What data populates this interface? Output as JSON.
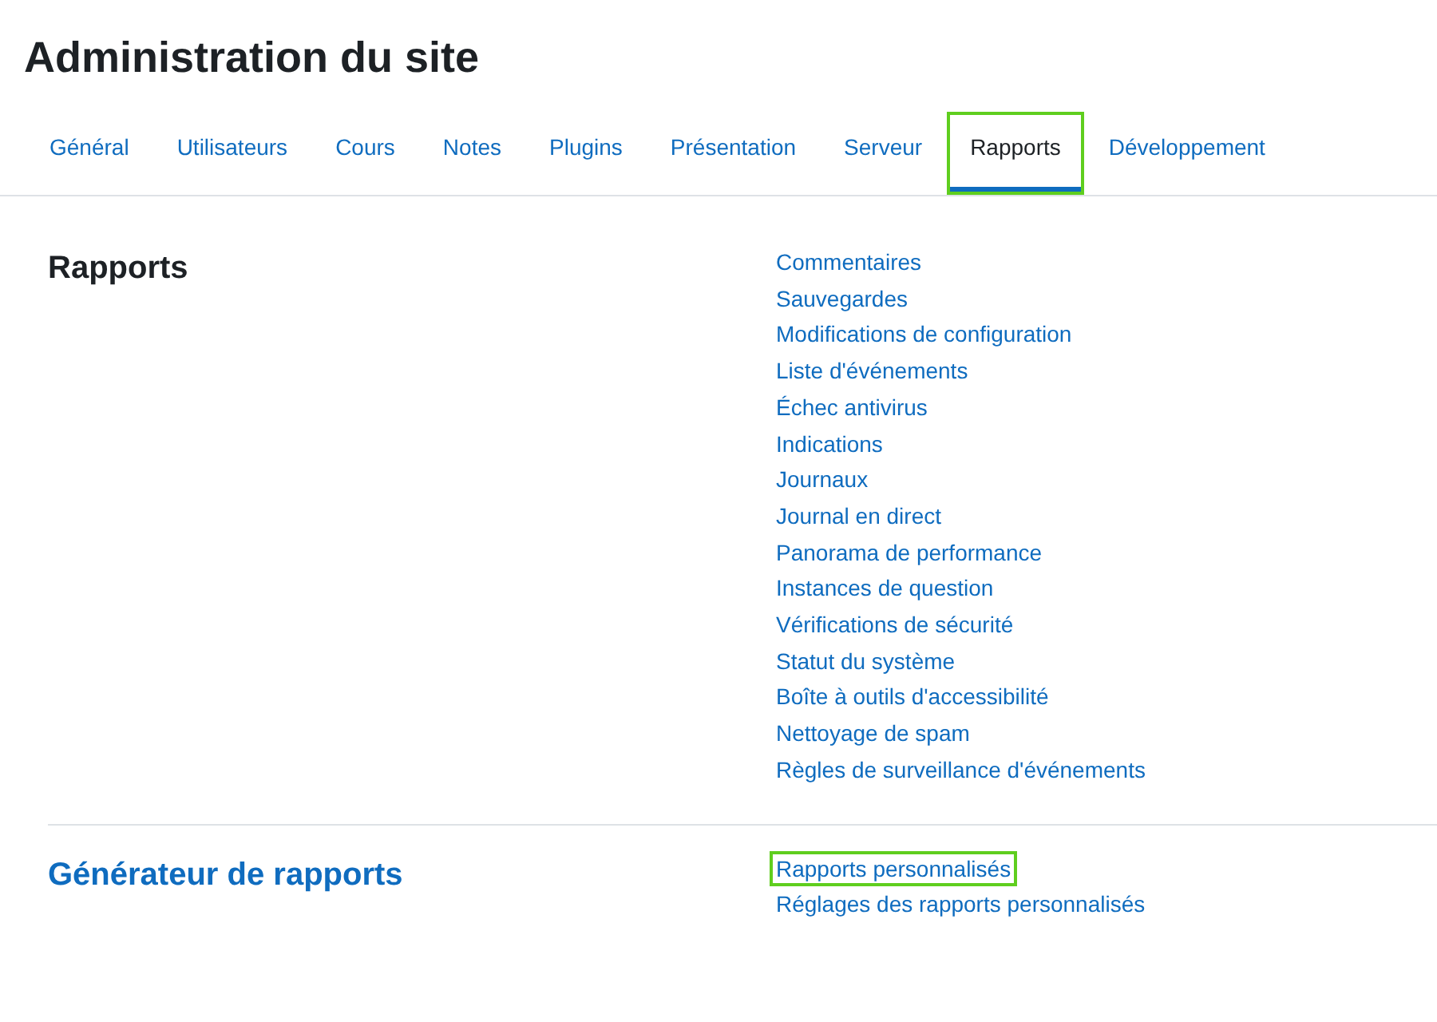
{
  "page_title": "Administration du site",
  "tabs": [
    {
      "label": "Général",
      "selected": false,
      "highlighted": false
    },
    {
      "label": "Utilisateurs",
      "selected": false,
      "highlighted": false
    },
    {
      "label": "Cours",
      "selected": false,
      "highlighted": false
    },
    {
      "label": "Notes",
      "selected": false,
      "highlighted": false
    },
    {
      "label": "Plugins",
      "selected": false,
      "highlighted": false
    },
    {
      "label": "Présentation",
      "selected": false,
      "highlighted": false
    },
    {
      "label": "Serveur",
      "selected": false,
      "highlighted": false
    },
    {
      "label": "Rapports",
      "selected": true,
      "highlighted": true
    },
    {
      "label": "Développement",
      "selected": false,
      "highlighted": false
    }
  ],
  "sections": [
    {
      "title": "Rapports",
      "kind": "heading",
      "links": [
        {
          "label": "Commentaires",
          "highlighted": false
        },
        {
          "label": "Sauvegardes",
          "highlighted": false
        },
        {
          "label": "Modifications de configuration",
          "highlighted": false
        },
        {
          "label": "Liste d'événements",
          "highlighted": false
        },
        {
          "label": "Échec antivirus",
          "highlighted": false
        },
        {
          "label": "Indications",
          "highlighted": false
        },
        {
          "label": "Journaux",
          "highlighted": false
        },
        {
          "label": "Journal en direct",
          "highlighted": false
        },
        {
          "label": "Panorama de performance",
          "highlighted": false
        },
        {
          "label": "Instances de question",
          "highlighted": false
        },
        {
          "label": "Vérifications de sécurité",
          "highlighted": false
        },
        {
          "label": "Statut du système",
          "highlighted": false
        },
        {
          "label": "Boîte à outils d'accessibilité",
          "highlighted": false
        },
        {
          "label": "Nettoyage de spam",
          "highlighted": false
        },
        {
          "label": "Règles de surveillance d'événements",
          "highlighted": false
        }
      ]
    },
    {
      "title": "Générateur de rapports",
      "kind": "link",
      "links": [
        {
          "label": "Rapports personnalisés",
          "highlighted": true
        },
        {
          "label": "Réglages des rapports personnalisés",
          "highlighted": false
        }
      ]
    }
  ]
}
